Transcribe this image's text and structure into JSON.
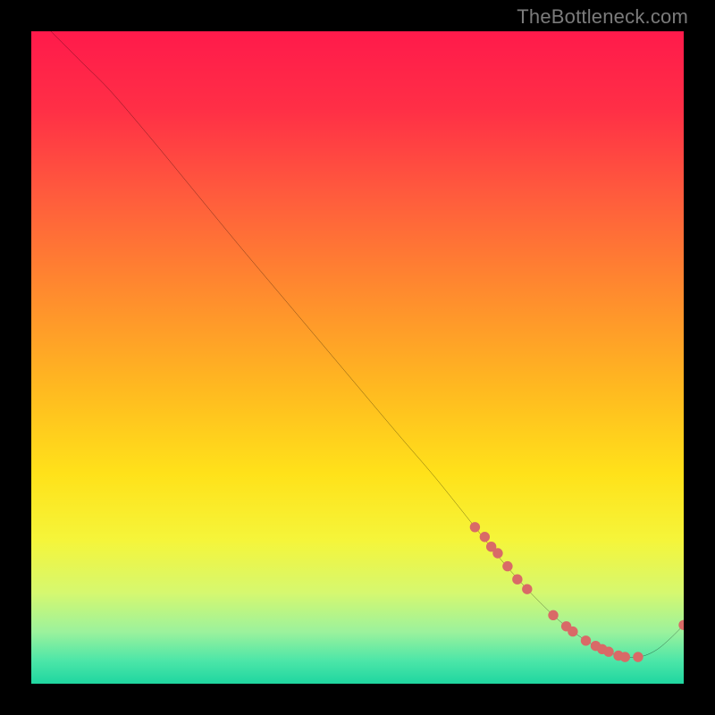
{
  "watermark": "TheBottleneck.com",
  "chart_data": {
    "type": "line",
    "title": "",
    "xlabel": "",
    "ylabel": "",
    "xlim": [
      0,
      100
    ],
    "ylim": [
      0,
      100
    ],
    "grid": false,
    "legend": false,
    "curve": {
      "name": "bottleneck-curve",
      "color": "#000000",
      "x": [
        3,
        5,
        8,
        12,
        18,
        25,
        32,
        40,
        48,
        56,
        62,
        68,
        72,
        76,
        80,
        83,
        86,
        88,
        90,
        92,
        94,
        96,
        98,
        100
      ],
      "y": [
        100,
        98,
        95,
        91,
        84,
        75.5,
        67,
        57.5,
        48,
        38.5,
        31.5,
        24,
        19,
        14.5,
        10.5,
        8,
        6,
        5,
        4.3,
        4,
        4.3,
        5.3,
        7,
        9
      ]
    },
    "points": {
      "name": "highlight-dots",
      "color": "#d96a67",
      "radius": 5,
      "x": [
        68,
        69.5,
        70.5,
        71.5,
        73,
        74.5,
        76,
        80,
        82,
        83,
        85,
        86.5,
        87.5,
        88.5,
        90,
        91,
        93,
        100
      ],
      "y": [
        24,
        22.5,
        21,
        20,
        18,
        16,
        14.5,
        10.5,
        8.8,
        8,
        6.6,
        5.8,
        5.3,
        4.9,
        4.3,
        4.1,
        4.1,
        9
      ]
    },
    "background_gradient": {
      "stops": [
        {
          "offset": 0.0,
          "color": "#ff1a4b"
        },
        {
          "offset": 0.12,
          "color": "#ff2f46"
        },
        {
          "offset": 0.25,
          "color": "#ff5b3d"
        },
        {
          "offset": 0.4,
          "color": "#ff8b2e"
        },
        {
          "offset": 0.55,
          "color": "#ffba20"
        },
        {
          "offset": 0.68,
          "color": "#ffe21a"
        },
        {
          "offset": 0.78,
          "color": "#f5f53a"
        },
        {
          "offset": 0.86,
          "color": "#d6f86f"
        },
        {
          "offset": 0.92,
          "color": "#9cf29c"
        },
        {
          "offset": 0.965,
          "color": "#4ce6a8"
        },
        {
          "offset": 1.0,
          "color": "#1fd6a0"
        }
      ]
    }
  }
}
